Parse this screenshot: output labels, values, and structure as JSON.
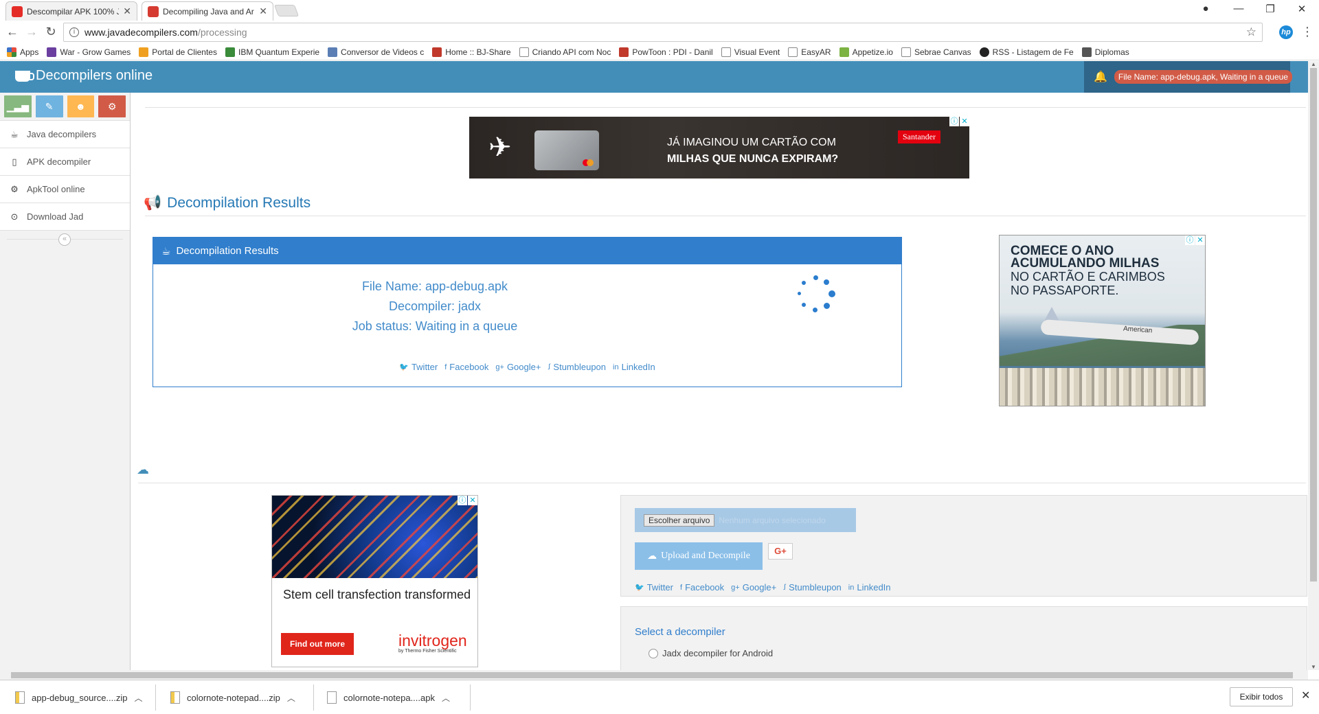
{
  "browser": {
    "tabs": [
      {
        "title": "Descompilar APK 100% J",
        "favicon_color": "#e52d27",
        "active": false
      },
      {
        "title": "Decompiling Java and Ar",
        "favicon_color": "#d63b31",
        "active": true
      }
    ],
    "url_host": "www.javadecompilers.com",
    "url_path": "/processing",
    "bookmarks": [
      {
        "label": "Apps",
        "icon_color": "#e84c3d"
      },
      {
        "label": "War - Grow Games",
        "icon_color": "#6b3fa0"
      },
      {
        "label": "Portal de Clientes",
        "icon_color": "#f0a020"
      },
      {
        "label": "IBM Quantum Experie",
        "icon_color": "#3a8b3a"
      },
      {
        "label": "Conversor de Videos c",
        "icon_color": "#5b7fb5"
      },
      {
        "label": "Home :: BJ-Share",
        "icon_color": "#c0392b"
      },
      {
        "label": "Criando API com Noc",
        "icon_color": "#888888"
      },
      {
        "label": "PowToon : PDI - Danil",
        "icon_color": "#c0392b"
      },
      {
        "label": "Visual Event",
        "icon_color": "#888888"
      },
      {
        "label": "EasyAR",
        "icon_color": "#888888"
      },
      {
        "label": "Appetize.io",
        "icon_color": "#7cb342"
      },
      {
        "label": "Sebrae Canvas",
        "icon_color": "#888888"
      },
      {
        "label": "RSS - Listagem de Fe",
        "icon_color": "#222222"
      },
      {
        "label": "Diplomas",
        "icon_color": "#555555"
      }
    ]
  },
  "site": {
    "brand": "Decompilers online",
    "notification": "File Name: app-debug.apk, Waiting in a queue",
    "shortcut_colors": [
      "#87b87f",
      "#6fb3e0",
      "#ffb752",
      "#d15b47"
    ],
    "nav": [
      {
        "label": "Java decompilers",
        "icon": "coffee-icon"
      },
      {
        "label": "APK decompiler",
        "icon": "mobile-icon"
      },
      {
        "label": "ApkTool online",
        "icon": "cog-icon"
      },
      {
        "label": "Download Jad",
        "icon": "download-icon"
      }
    ],
    "section_title": "Decompilation Results",
    "results": {
      "header": "Decompilation Results",
      "file_name": "File Name: app-debug.apk",
      "decompiler": "Decompiler: jadx",
      "status": "Job status: Waiting in a queue"
    },
    "share": [
      "Twitter",
      "Facebook",
      "Google+",
      "Stumbleupon",
      "LinkedIn"
    ],
    "upload": {
      "choose_label": "Escolher arquivo",
      "no_file": "Nenhum arquivo selecionado",
      "button": "Upload and Decompile",
      "gplus": "G+"
    },
    "share2": [
      "Twitter",
      "Facebook",
      "Google+",
      "Stumbleupon",
      "LinkedIn"
    ],
    "select_label": "Select a decompiler",
    "select_option": "Jadx decompiler for Android"
  },
  "ads": {
    "banner": {
      "line1": "JÁ IMAGINOU UM CARTÃO COM",
      "line2": "MILHAS QUE NUNCA EXPIRAM?",
      "brand": "Santander"
    },
    "square": {
      "line1": "COMECE O ANO",
      "line2": "ACUMULANDO MILHAS",
      "line3": "NO CARTÃO E CARIMBOS",
      "line4": "NO PASSAPORTE.",
      "plane_label": "American"
    },
    "dna": {
      "headline": "Stem cell transfection transformed",
      "button": "Find out more",
      "brand": "invitrogen",
      "brand_sub": "by Thermo Fisher Scientific"
    }
  },
  "downloads": [
    {
      "name": "app-debug_source....zip",
      "type": "zip"
    },
    {
      "name": "colornote-notepad....zip",
      "type": "zip"
    },
    {
      "name": "colornote-notepa....apk",
      "type": "file"
    }
  ],
  "show_all": "Exibir todos"
}
